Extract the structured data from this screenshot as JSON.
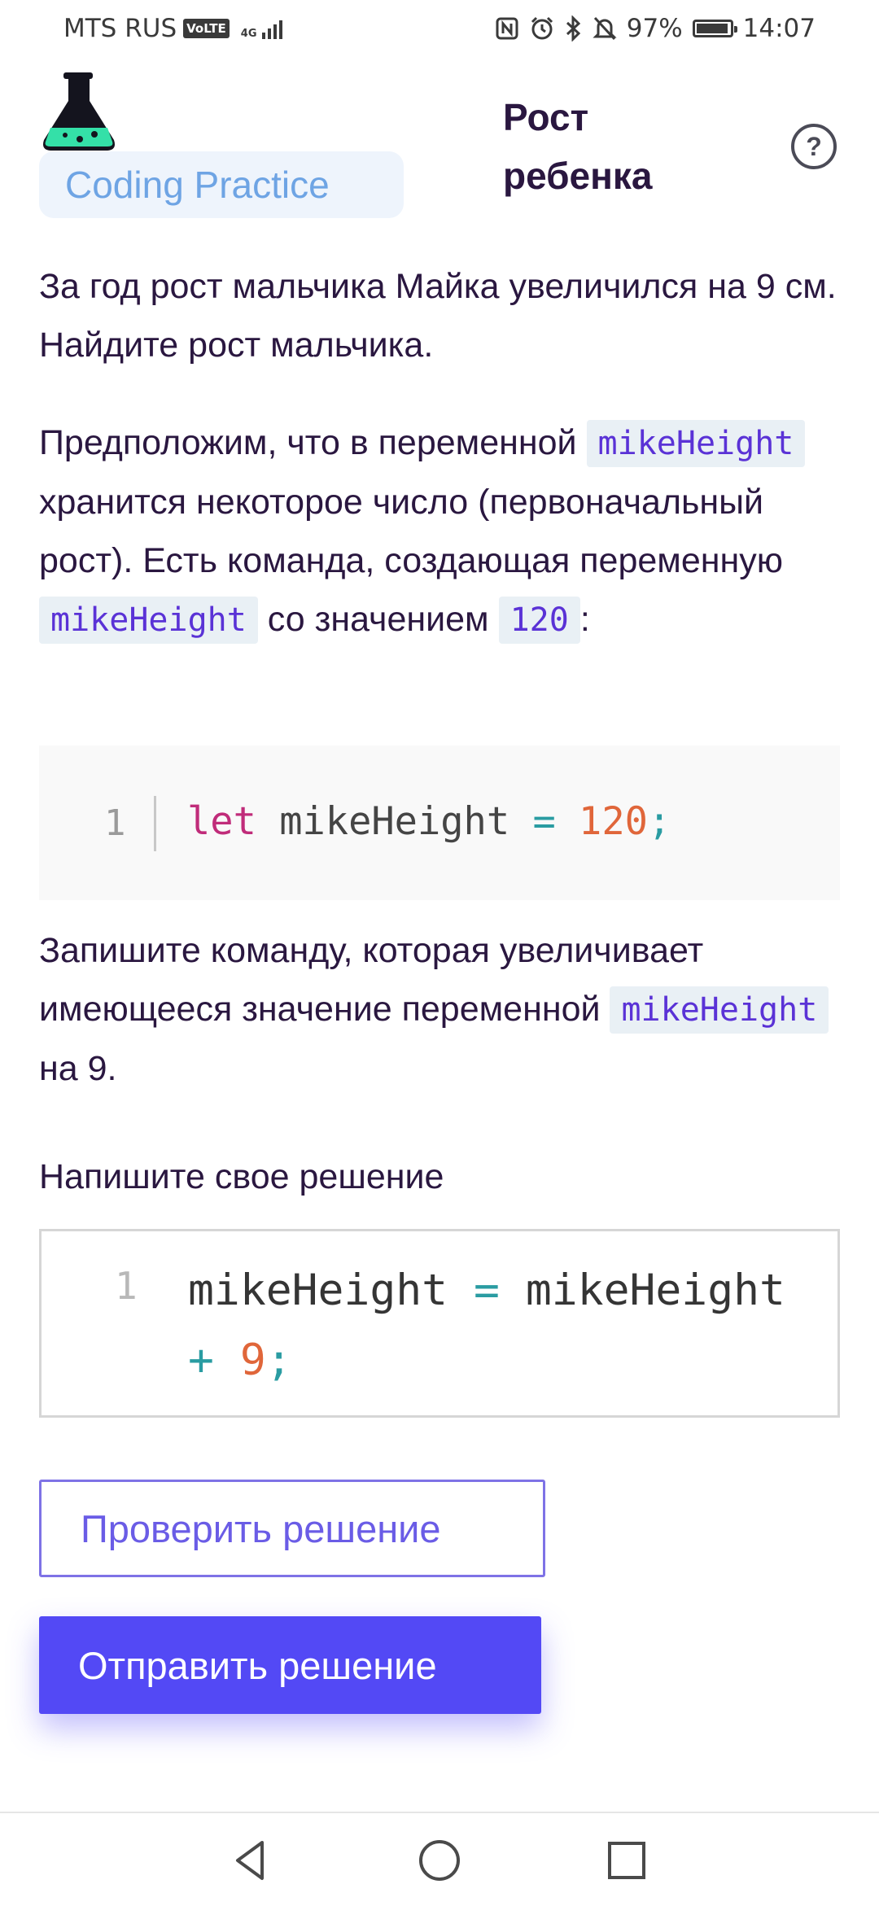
{
  "status_bar": {
    "carrier": "MTS RUS",
    "volte": "VoLTE",
    "network": "4G",
    "battery_percent": "97%",
    "battery_level": 0.97,
    "time": "14:07",
    "icons": [
      "nfc-icon",
      "alarm-icon",
      "bluetooth-icon",
      "silent-icon",
      "battery-icon"
    ]
  },
  "header": {
    "brand": "Coding Practice",
    "title": "Рост ребенка",
    "help_icon": "question-mark-icon"
  },
  "task": {
    "para1": "За год рост мальчика Майка увеличился на 9 см. Найдите рост мальчика.",
    "para2_a": "Предположим, что в переменной",
    "var_name": "mikeHeight",
    "para2_b": "хранится некоторое число (первоначальный рост). Есть команда, создающая переменную",
    "para2_c": "со значением",
    "value": "120",
    "para2_d": ":",
    "para3_a": "Запишите команду, которая увеличивает имеющееся значение переменной",
    "para3_b": "на 9."
  },
  "code_sample": {
    "line_number": "1",
    "keyword": "let",
    "identifier": "mikeHeight",
    "operator": "=",
    "number": "120",
    "terminator": ";"
  },
  "solution": {
    "label": "Напишите свое решение",
    "line_number": "1",
    "ident1": "mikeHeight",
    "op_assign": "=",
    "ident2": "mikeHeight",
    "op_plus": "+",
    "number": "9",
    "terminator": ";"
  },
  "buttons": {
    "check": "Проверить решение",
    "submit": "Отправить решение"
  },
  "colors": {
    "accent": "#5349f5",
    "brand_text": "#6ea4e4",
    "keyword": "#c02c7a",
    "operator": "#2a9ca2",
    "number": "#e0663a"
  },
  "nav": [
    "back-icon",
    "home-icon",
    "recents-icon"
  ]
}
